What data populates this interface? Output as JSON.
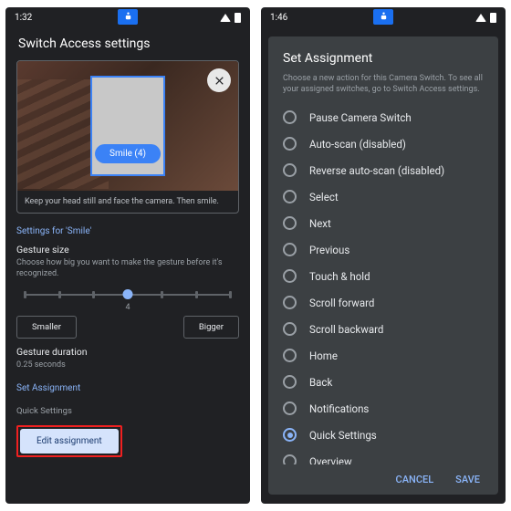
{
  "left": {
    "time": "1:32",
    "title": "Switch Access settings",
    "pill": "Smile (4)",
    "instruction": "Keep your head still and face the camera. Then smile.",
    "section": "Settings for 'Smile'",
    "gesture_size_label": "Gesture size",
    "gesture_size_desc": "Choose how big you want to make the gesture before it's recognized.",
    "slider_value": "4",
    "smaller": "Smaller",
    "bigger": "Bigger",
    "duration_label": "Gesture duration",
    "duration_value": "0.25 seconds",
    "set_assignment": "Set Assignment",
    "quick_settings": "Quick Settings",
    "edit_assignment": "Edit assignment"
  },
  "right": {
    "time": "1:46",
    "title": "Set Assignment",
    "subtitle": "Choose a new action for this Camera Switch. To see all your assigned switches, go to Switch Access settings.",
    "options": [
      "Pause Camera Switch",
      "Auto-scan (disabled)",
      "Reverse auto-scan (disabled)",
      "Select",
      "Next",
      "Previous",
      "Touch & hold",
      "Scroll forward",
      "Scroll backward",
      "Home",
      "Back",
      "Notifications",
      "Quick Settings",
      "Overview"
    ],
    "selected_index": 12,
    "cancel": "CANCEL",
    "save": "SAVE"
  }
}
